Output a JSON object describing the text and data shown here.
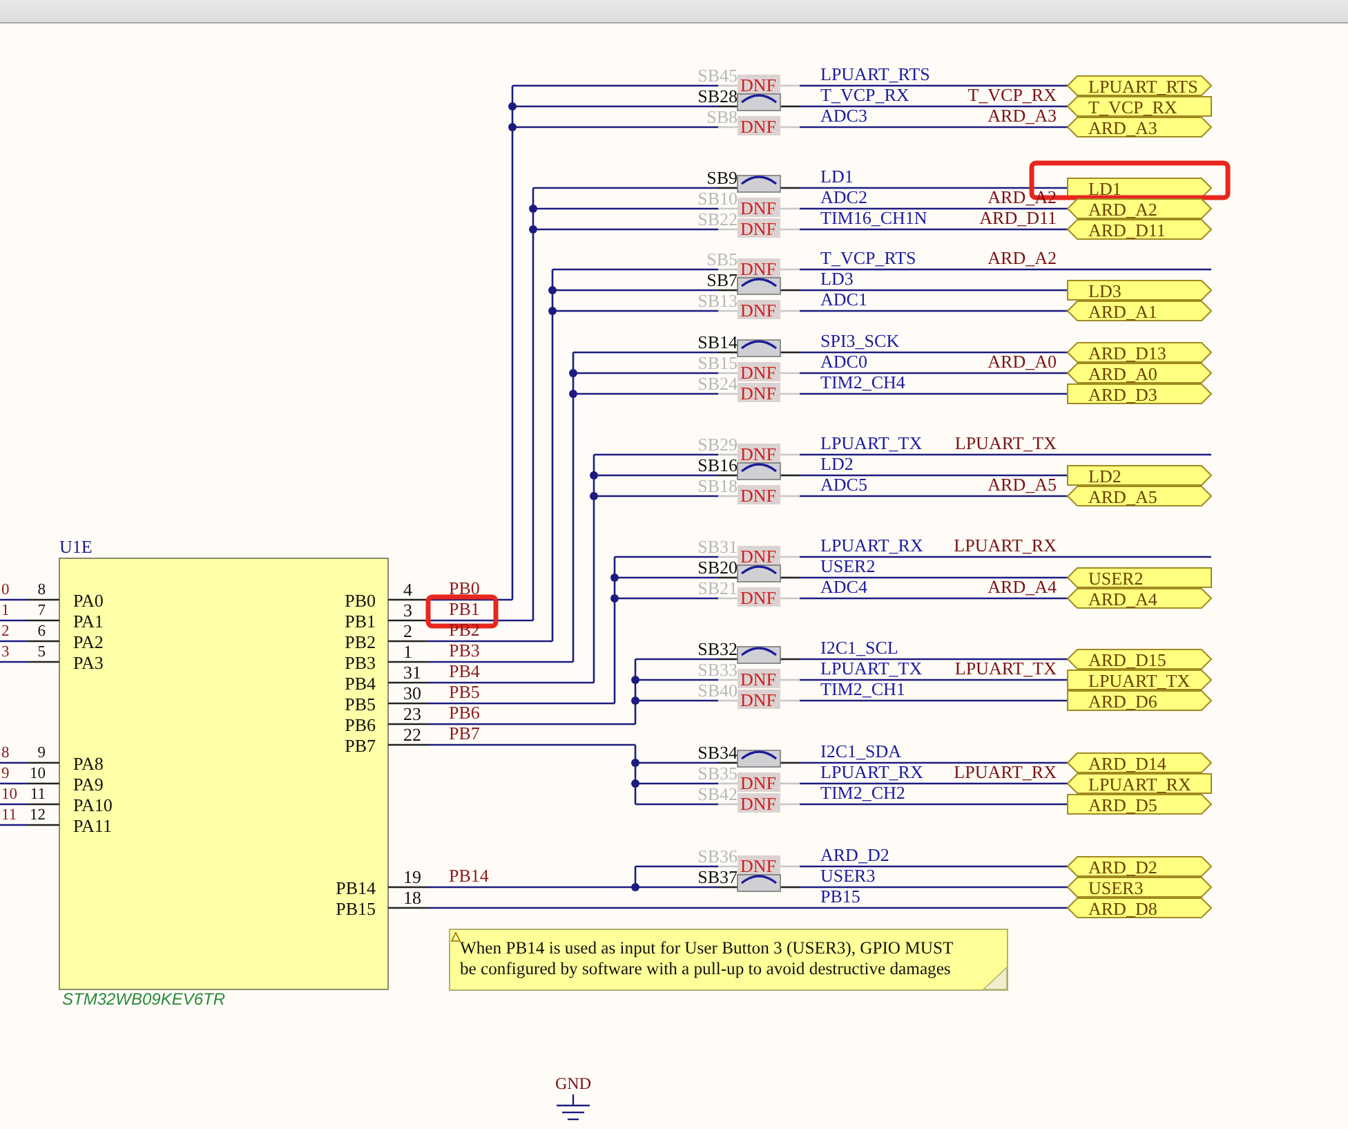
{
  "component": {
    "designator": "U1E",
    "part_number": "STM32WB09KEV6TR",
    "left_pins": [
      {
        "name": "PA0",
        "number": "8",
        "net": "0"
      },
      {
        "name": "PA1",
        "number": "7",
        "net": "1"
      },
      {
        "name": "PA2",
        "number": "6",
        "net": "2"
      },
      {
        "name": "PA3",
        "number": "5",
        "net": "3"
      },
      {
        "name": "PA8",
        "number": "9",
        "net": "8"
      },
      {
        "name": "PA9",
        "number": "10",
        "net": "9"
      },
      {
        "name": "PA10",
        "number": "11",
        "net": "10"
      },
      {
        "name": "PA11",
        "number": "12",
        "net": "11"
      }
    ],
    "right_pins": [
      {
        "name": "PB0",
        "number": "4",
        "net": "PB0",
        "highlighted": false
      },
      {
        "name": "PB1",
        "number": "3",
        "net": "PB1",
        "highlighted": true
      },
      {
        "name": "PB2",
        "number": "2",
        "net": "PB2",
        "highlighted": false
      },
      {
        "name": "PB3",
        "number": "1",
        "net": "PB3",
        "highlighted": false
      },
      {
        "name": "PB4",
        "number": "31",
        "net": "PB4",
        "highlighted": false
      },
      {
        "name": "PB5",
        "number": "30",
        "net": "PB5",
        "highlighted": false
      },
      {
        "name": "PB6",
        "number": "23",
        "net": "PB6",
        "highlighted": false
      },
      {
        "name": "PB7",
        "number": "22",
        "net": "PB7",
        "highlighted": false
      },
      {
        "name": "PB14",
        "number": "19",
        "net": "PB14",
        "highlighted": false
      },
      {
        "name": "PB15",
        "number": "18",
        "highlighted": false
      }
    ]
  },
  "bridge_groups": [
    {
      "rows": [
        {
          "kind": "bridge",
          "designator": "SB45",
          "fitted": false,
          "dnf": "DNF",
          "net": "LPUART_RTS",
          "port": {
            "text": "LPUART_RTS",
            "kind": "bidirectional",
            "highlighted": false
          }
        },
        {
          "kind": "bridge",
          "designator": "SB28",
          "fitted": true,
          "net": "T_VCP_RX",
          "label": "T_VCP_RX",
          "port": {
            "text": "T_VCP_RX",
            "kind": "input",
            "highlighted": false
          }
        },
        {
          "kind": "bridge",
          "designator": "SB8",
          "fitted": false,
          "dnf": "DNF",
          "net": "ADC3",
          "label": "ARD_A3",
          "port": {
            "text": "ARD_A3",
            "kind": "bidirectional",
            "highlighted": false
          }
        }
      ]
    },
    {
      "rows": [
        {
          "kind": "bridge",
          "designator": "SB9",
          "fitted": true,
          "net": "LD1",
          "port": {
            "text": "LD1",
            "kind": "output",
            "highlighted": true
          }
        },
        {
          "kind": "bridge",
          "designator": "SB10",
          "fitted": false,
          "dnf": "DNF",
          "net": "ADC2",
          "label": "ARD_A2",
          "port": {
            "text": "ARD_A2",
            "kind": "bidirectional",
            "highlighted": false
          }
        },
        {
          "kind": "bridge",
          "designator": "SB22",
          "fitted": false,
          "dnf": "DNF",
          "net": "TIM16_CH1N",
          "label": "ARD_D11",
          "port": {
            "text": "ARD_D11",
            "kind": "bidirectional",
            "highlighted": false
          }
        }
      ]
    },
    {
      "rows": [
        {
          "kind": "bridge",
          "designator": "SB5",
          "fitted": false,
          "dnf": "DNF",
          "net": "T_VCP_RTS",
          "label": "ARD_A2"
        },
        {
          "kind": "bridge",
          "designator": "SB7",
          "fitted": true,
          "net": "LD3",
          "port": {
            "text": "LD3",
            "kind": "output",
            "highlighted": false
          }
        },
        {
          "kind": "bridge",
          "designator": "SB13",
          "fitted": false,
          "dnf": "DNF",
          "net": "ADC1",
          "port": {
            "text": "ARD_A1",
            "kind": "bidirectional",
            "highlighted": false
          }
        }
      ]
    },
    {
      "rows": [
        {
          "kind": "bridge",
          "designator": "SB14",
          "fitted": true,
          "net": "SPI3_SCK",
          "port": {
            "text": "ARD_D13",
            "kind": "bidirectional",
            "highlighted": false
          }
        },
        {
          "kind": "bridge",
          "designator": "SB15",
          "fitted": false,
          "dnf": "DNF",
          "net": "ADC0",
          "label": "ARD_A0",
          "port": {
            "text": "ARD_A0",
            "kind": "bidirectional",
            "highlighted": false
          }
        },
        {
          "kind": "bridge",
          "designator": "SB24",
          "fitted": false,
          "dnf": "DNF",
          "net": "TIM2_CH4",
          "port": {
            "text": "ARD_D3",
            "kind": "output",
            "highlighted": false
          }
        }
      ]
    },
    {
      "rows": [
        {
          "kind": "bridge",
          "designator": "SB29",
          "fitted": false,
          "dnf": "DNF",
          "net": "LPUART_TX",
          "label": "LPUART_TX"
        },
        {
          "kind": "bridge",
          "designator": "SB16",
          "fitted": true,
          "net": "LD2",
          "port": {
            "text": "LD2",
            "kind": "output",
            "highlighted": false
          }
        },
        {
          "kind": "bridge",
          "designator": "SB18",
          "fitted": false,
          "dnf": "DNF",
          "net": "ADC5",
          "label": "ARD_A5",
          "port": {
            "text": "ARD_A5",
            "kind": "bidirectional",
            "highlighted": false
          }
        }
      ]
    },
    {
      "rows": [
        {
          "kind": "bridge",
          "designator": "SB31",
          "fitted": false,
          "dnf": "DNF",
          "net": "LPUART_RX",
          "label": "LPUART_RX"
        },
        {
          "kind": "bridge",
          "designator": "SB20",
          "fitted": true,
          "net": "USER2",
          "port": {
            "text": "USER2",
            "kind": "input",
            "highlighted": false
          }
        },
        {
          "kind": "bridge",
          "designator": "SB21",
          "fitted": false,
          "dnf": "DNF",
          "net": "ADC4",
          "label": "ARD_A4",
          "port": {
            "text": "ARD_A4",
            "kind": "bidirectional",
            "highlighted": false
          }
        }
      ]
    },
    {
      "rows": [
        {
          "kind": "bridge",
          "designator": "SB32",
          "fitted": true,
          "net": "I2C1_SCL",
          "port": {
            "text": "ARD_D15",
            "kind": "bidirectional",
            "highlighted": false
          }
        },
        {
          "kind": "bridge",
          "designator": "SB33",
          "fitted": false,
          "dnf": "DNF",
          "net": "LPUART_TX",
          "label": "LPUART_TX",
          "port": {
            "text": "LPUART_TX",
            "kind": "output",
            "highlighted": false
          }
        },
        {
          "kind": "bridge",
          "designator": "SB40",
          "fitted": false,
          "dnf": "DNF",
          "net": "TIM2_CH1",
          "port": {
            "text": "ARD_D6",
            "kind": "output",
            "highlighted": false
          }
        }
      ]
    },
    {
      "rows": [
        {
          "kind": "bridge",
          "designator": "SB34",
          "fitted": true,
          "net": "I2C1_SDA",
          "port": {
            "text": "ARD_D14",
            "kind": "bidirectional",
            "highlighted": false
          }
        },
        {
          "kind": "bridge",
          "designator": "SB35",
          "fitted": false,
          "dnf": "DNF",
          "net": "LPUART_RX",
          "label": "LPUART_RX",
          "port": {
            "text": "LPUART_RX",
            "kind": "input",
            "highlighted": false
          }
        },
        {
          "kind": "bridge",
          "designator": "SB42",
          "fitted": false,
          "dnf": "DNF",
          "net": "TIM2_CH2",
          "port": {
            "text": "ARD_D5",
            "kind": "output",
            "highlighted": false
          }
        }
      ]
    },
    {
      "rows": [
        {
          "kind": "bridge",
          "designator": "SB36",
          "fitted": false,
          "dnf": "DNF",
          "net": "ARD_D2",
          "port": {
            "text": "ARD_D2",
            "kind": "bidirectional",
            "highlighted": false
          }
        },
        {
          "kind": "bridge",
          "designator": "SB37",
          "fitted": true,
          "net": "USER3",
          "port": {
            "text": "USER3",
            "kind": "bidirectional",
            "highlighted": false
          }
        }
      ]
    },
    {
      "rows": [
        {
          "kind": "direct",
          "net": "PB15",
          "port": {
            "text": "ARD_D8",
            "kind": "bidirectional",
            "highlighted": false
          }
        }
      ]
    }
  ],
  "note": {
    "text": "When PB14 is used as input for User Button 3 (USER3), GPIO MUST be configured by software with a pull-up to avoid destructive damages"
  },
  "ground": {
    "label": "GND"
  }
}
